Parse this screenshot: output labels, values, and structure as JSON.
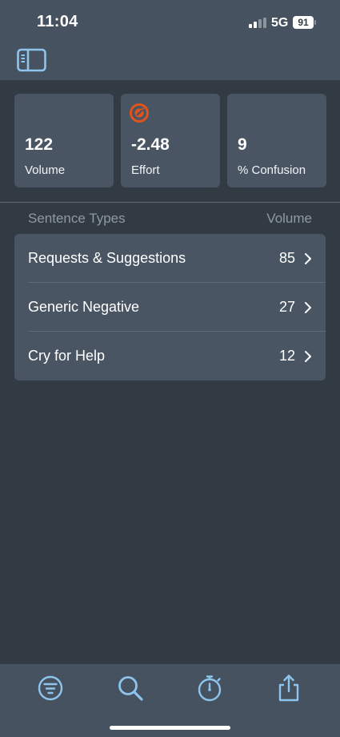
{
  "status_bar": {
    "time": "11:04",
    "network": "5G",
    "battery": "91"
  },
  "summary_cards": [
    {
      "value": "122",
      "label": "Volume"
    },
    {
      "value": "-2.48",
      "label": "Effort",
      "icon": "effort-dial-icon",
      "icon_color": "#e0541c"
    },
    {
      "value": "9",
      "label": "% Confusion"
    }
  ],
  "list": {
    "header_left": "Sentence Types",
    "header_right": "Volume",
    "rows": [
      {
        "label": "Requests & Suggestions",
        "count": "85"
      },
      {
        "label": "Generic Negative",
        "count": "27"
      },
      {
        "label": "Cry for Help",
        "count": "12"
      }
    ]
  },
  "tab_bar": {
    "items": [
      "filter-icon",
      "search-icon",
      "stopwatch-icon",
      "share-icon"
    ]
  },
  "colors": {
    "accent": "#8ec5ee",
    "background": "#323b44",
    "card": "#4a5563",
    "header": "#46525f"
  }
}
